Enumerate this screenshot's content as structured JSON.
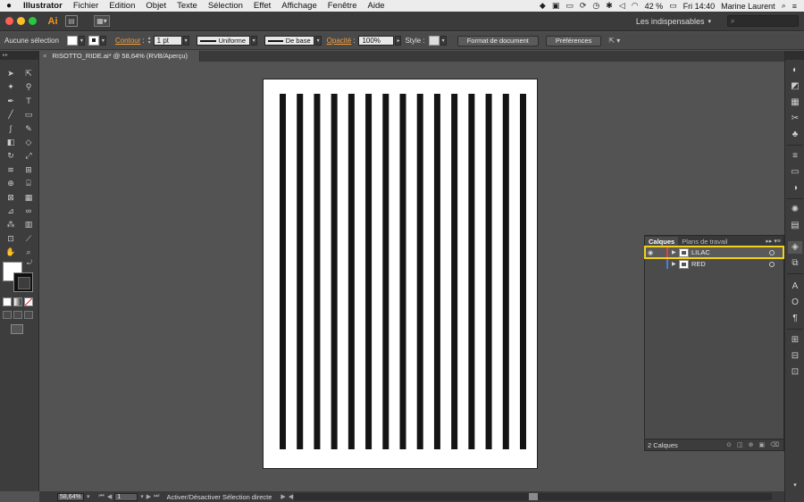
{
  "menubar": {
    "apple": "",
    "app_name": "Illustrator",
    "items": [
      "Fichier",
      "Edition",
      "Objet",
      "Texte",
      "Sélection",
      "Effet",
      "Affichage",
      "Fenêtre",
      "Aide"
    ],
    "battery": "42 %",
    "clock": "Fri 14:40",
    "user": "Marine Laurent"
  },
  "appbar": {
    "logo": "Ai",
    "workspace": "Les indispensables",
    "search_placeholder": ""
  },
  "controlbar": {
    "selection_label": "Aucune sélection",
    "contour_label": "Contour",
    "stroke_weight": "1 pt",
    "profile_uniform": "Uniforme",
    "brush_base": "De base",
    "opacity_label": "Opacité",
    "opacity_value": "100%",
    "style_label": "Style :",
    "doc_format_btn": "Format de document",
    "prefs_btn": "Préférences"
  },
  "document": {
    "tab_title": "RISOTTO_RIDE.ai* @ 58,64% (RVB/Aperçu)",
    "close_glyph": "×"
  },
  "artwork": {
    "stripe_count": 15,
    "stripe_color": "#141414"
  },
  "statusbar": {
    "zoom": "58,64%",
    "artboard_num": "1",
    "status_text": "Activer/Désactiver Sélection directe"
  },
  "layers_panel": {
    "tab_layers": "Calques",
    "tab_artboards": "Plans de travail",
    "layers": [
      {
        "name": "LILAC",
        "color": "#e8413a",
        "selected": true
      },
      {
        "name": "RED",
        "color": "#4a7fd9",
        "selected": false
      }
    ],
    "count_label": "2 Calques"
  },
  "colors": {
    "accent_orange": "#f0a040",
    "selection_outline": "#f3d21b"
  },
  "icons": {
    "tools": [
      "selection-tool-icon",
      "direct-selection-tool-icon",
      "magic-wand-icon",
      "lasso-icon",
      "pen-icon",
      "type-icon",
      "line-icon",
      "rectangle-icon",
      "paintbrush-icon",
      "pencil-icon",
      "blob-brush-icon",
      "eraser-icon",
      "rotate-icon",
      "scale-icon",
      "warp-icon",
      "free-transform-icon",
      "shape-builder-icon",
      "perspective-icon",
      "mesh-icon",
      "gradient-icon",
      "eyedropper-icon",
      "blend-icon",
      "symbol-sprayer-icon",
      "graph-icon",
      "artboard-tool-icon",
      "slice-icon",
      "hand-icon",
      "zoom-icon"
    ],
    "dock": [
      "color-icon",
      "color-guide-icon",
      "swatches-icon",
      "brushes-icon",
      "symbols-icon",
      "stroke-icon",
      "gradient-panel-icon",
      "transparency-icon",
      "appearance-icon",
      "graphic-styles-icon",
      "layers-icon",
      "artboards-icon",
      "character-icon",
      "opentype-icon",
      "paragraph-icon",
      "transform-icon",
      "align-icon",
      "pathfinder-icon"
    ]
  }
}
